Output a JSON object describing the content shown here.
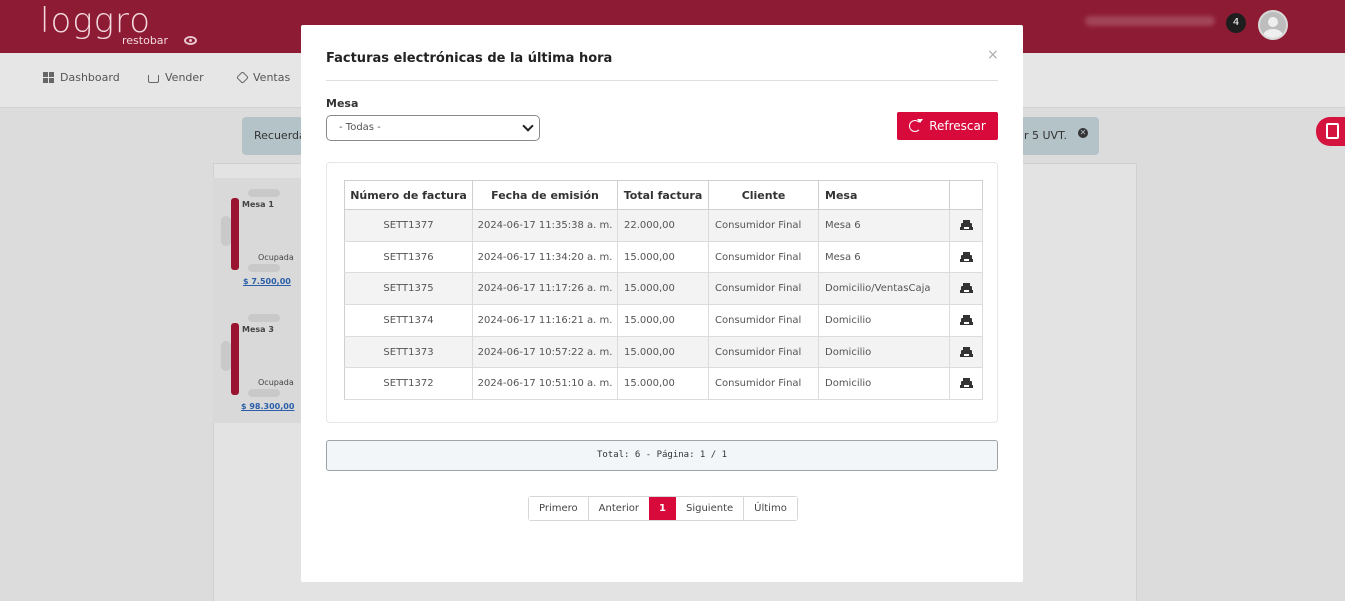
{
  "header": {
    "logo_text": "loggro",
    "logo_sub": "restobar",
    "notifications_count": "4"
  },
  "nav": {
    "items": [
      {
        "label": "Dashboard",
        "icon": "dashboard-icon"
      },
      {
        "label": "Vender",
        "icon": "cart-icon"
      },
      {
        "label": "Ventas",
        "icon": "tag-icon"
      }
    ]
  },
  "alert": {
    "left_text": "Recuerda",
    "right_text": "lar 5 UVT."
  },
  "tables": [
    {
      "name": "Mesa 1",
      "state": "Ocupada",
      "total": "$ 7.500,00"
    },
    {
      "name": "Mesa 3",
      "state": "Ocupada",
      "total": "$ 98.300,00"
    }
  ],
  "modal": {
    "title": "Facturas electrónicas de la última hora",
    "close": "×",
    "filter_label": "Mesa",
    "filter_value": "- Todas -",
    "refresh_label": "Refrescar",
    "columns": [
      "Número de factura",
      "Fecha de emisión",
      "Total factura",
      "Cliente",
      "Mesa",
      ""
    ],
    "rows": [
      {
        "number": "SETT1377",
        "date": "2024-06-17 11:35:38 a. m.",
        "total": "22.000,00",
        "client": "Consumidor Final",
        "mesa": "Mesa 6"
      },
      {
        "number": "SETT1376",
        "date": "2024-06-17 11:34:20 a. m.",
        "total": "15.000,00",
        "client": "Consumidor Final",
        "mesa": "Mesa 6"
      },
      {
        "number": "SETT1375",
        "date": "2024-06-17 11:17:26 a. m.",
        "total": "15.000,00",
        "client": "Consumidor Final",
        "mesa": "Domicilio/VentasCaja"
      },
      {
        "number": "SETT1374",
        "date": "2024-06-17 11:16:21 a. m.",
        "total": "15.000,00",
        "client": "Consumidor Final",
        "mesa": "Domicilio"
      },
      {
        "number": "SETT1373",
        "date": "2024-06-17 10:57:22 a. m.",
        "total": "15.000,00",
        "client": "Consumidor Final",
        "mesa": "Domicilio"
      },
      {
        "number": "SETT1372",
        "date": "2024-06-17 10:51:10 a. m.",
        "total": "15.000,00",
        "client": "Consumidor Final",
        "mesa": "Domicilio"
      }
    ],
    "summary": "Total: 6 - Página: 1 / 1",
    "pager": {
      "first": "Primero",
      "prev": "Anterior",
      "current": "1",
      "next": "Siguiente",
      "last": "Último"
    }
  },
  "colors": {
    "brand_dark": "#8e1b34",
    "accent": "#d80a3c"
  }
}
